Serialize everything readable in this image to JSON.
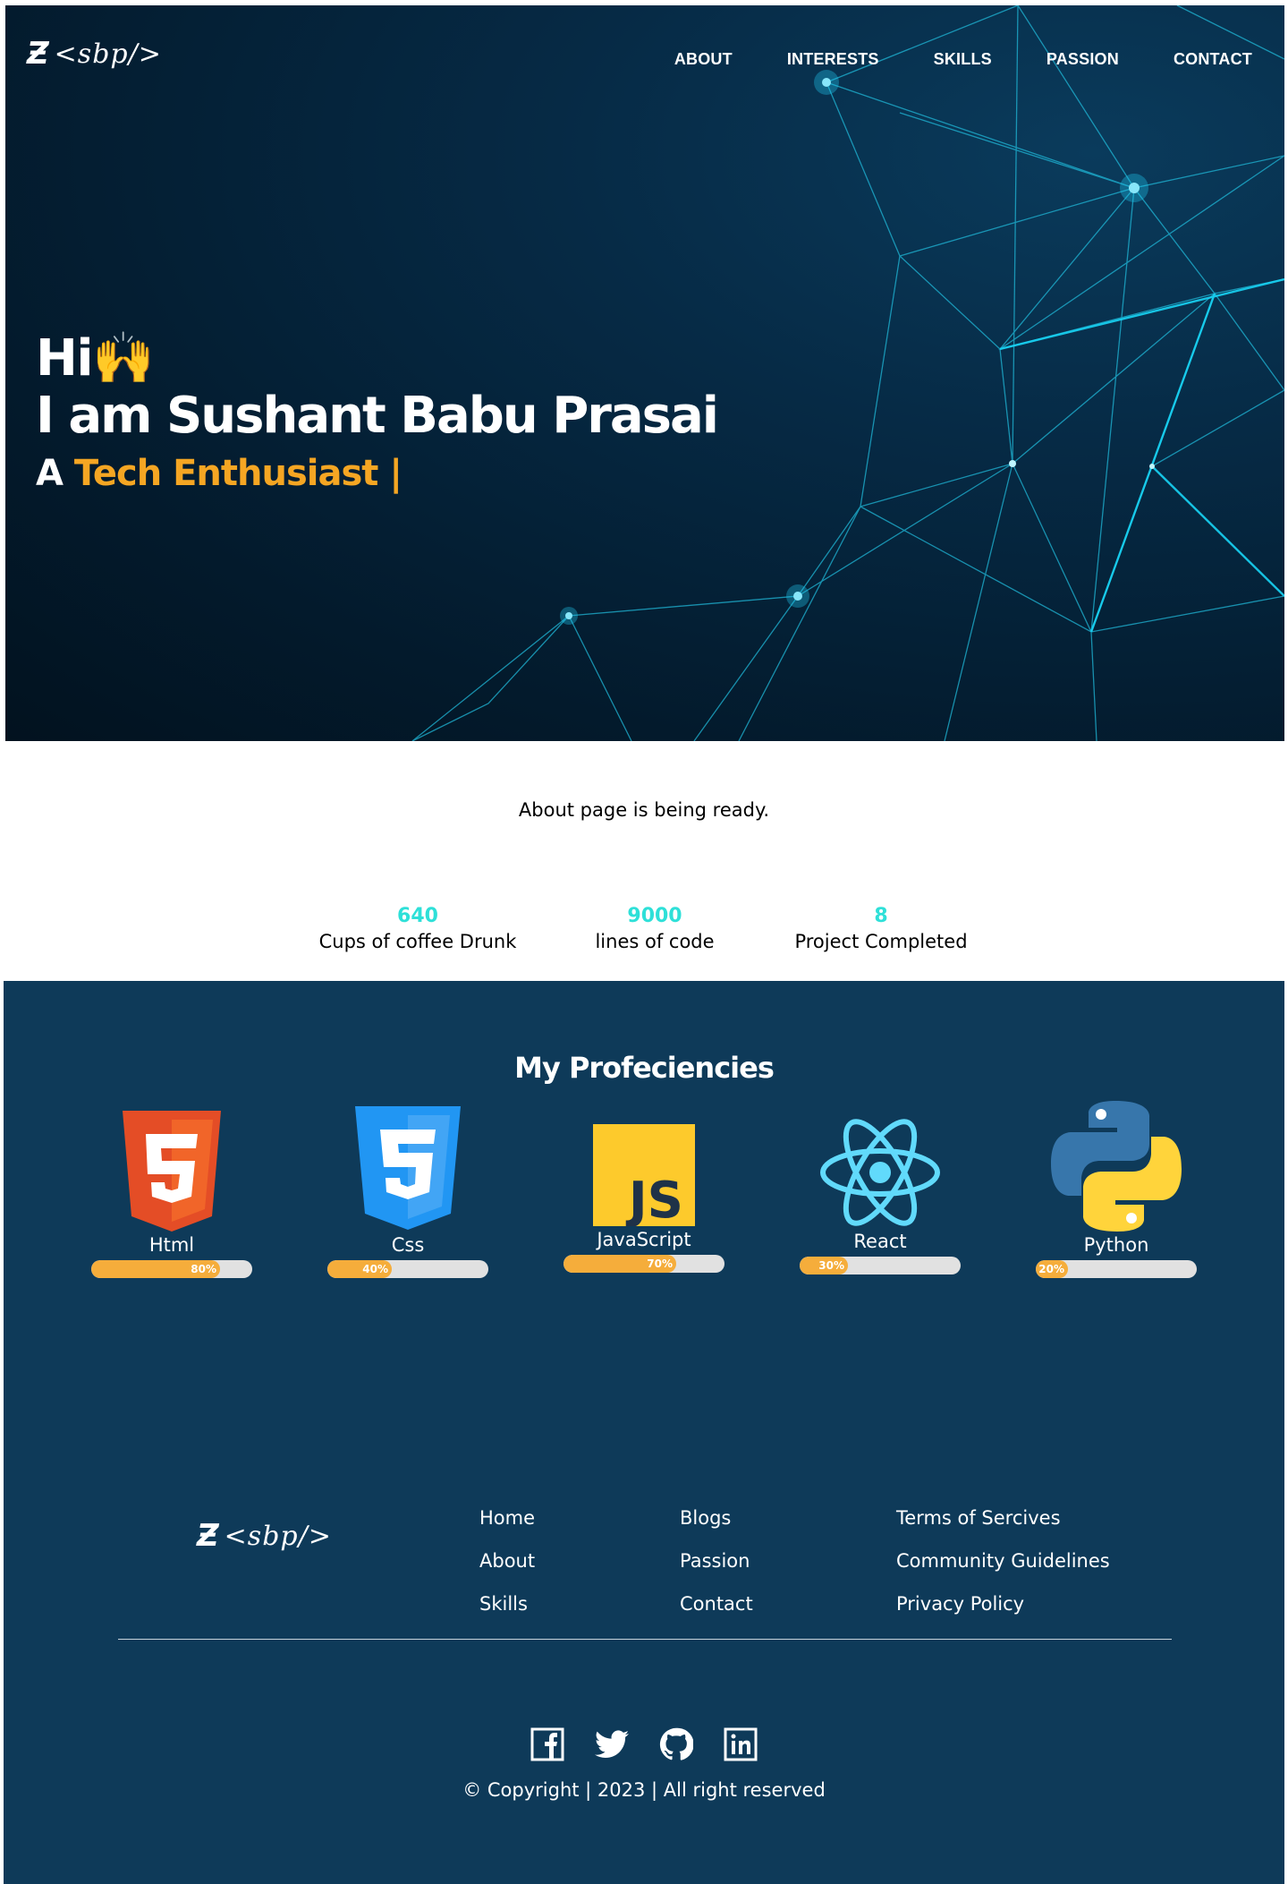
{
  "header": {
    "logo_text": "<sbp/>",
    "nav": [
      {
        "label": "ABOUT"
      },
      {
        "label": "INTERESTS"
      },
      {
        "label": "SKILLS"
      },
      {
        "label": "PASSION"
      },
      {
        "label": "CONTACT"
      }
    ]
  },
  "hero": {
    "greeting": "Hi🙌",
    "name_line": "I am Sushant Babu Prasai",
    "role_prefix": "A ",
    "role_highlight": "Tech Enthusiast |"
  },
  "about": {
    "message": "About page is being ready."
  },
  "stats": [
    {
      "number": "640",
      "label": "Cups of coffee Drunk"
    },
    {
      "number": "9000",
      "label": "lines of code"
    },
    {
      "number": "8",
      "label": "Project Completed"
    }
  ],
  "proficiencies": {
    "title": "My Profeciencies",
    "skills": [
      {
        "name": "Html",
        "percent": 80,
        "percent_label": "80%",
        "icon": "html5-icon"
      },
      {
        "name": "Css",
        "percent": 40,
        "percent_label": "40%",
        "icon": "css3-icon"
      },
      {
        "name": "JavaScript",
        "percent": 70,
        "percent_label": "70%",
        "icon": "javascript-icon"
      },
      {
        "name": "React",
        "percent": 30,
        "percent_label": "30%",
        "icon": "react-icon"
      },
      {
        "name": "Python",
        "percent": 20,
        "percent_label": "20%",
        "icon": "python-icon"
      }
    ]
  },
  "footer": {
    "logo_text": "<sbp/>",
    "col1": [
      {
        "label": "Home"
      },
      {
        "label": "About"
      },
      {
        "label": "Skills"
      }
    ],
    "col2": [
      {
        "label": "Blogs"
      },
      {
        "label": "Passion"
      },
      {
        "label": "Contact"
      }
    ],
    "col3": [
      {
        "label": "Terms of Sercives"
      },
      {
        "label": "Community Guidelines"
      },
      {
        "label": "Privacy Policy"
      }
    ],
    "socials": [
      "facebook-icon",
      "twitter-icon",
      "github-icon",
      "linkedin-icon"
    ],
    "copyright": "© Copyright | 2023 | All right reserved"
  },
  "colors": {
    "hero_bg": "#031a2c",
    "accent_orange": "#f5a623",
    "stat_teal": "#2ee0d8",
    "section_blue": "#0e3a59",
    "bar_fill": "#f5ad3b",
    "bar_track": "#e1e1e1"
  }
}
